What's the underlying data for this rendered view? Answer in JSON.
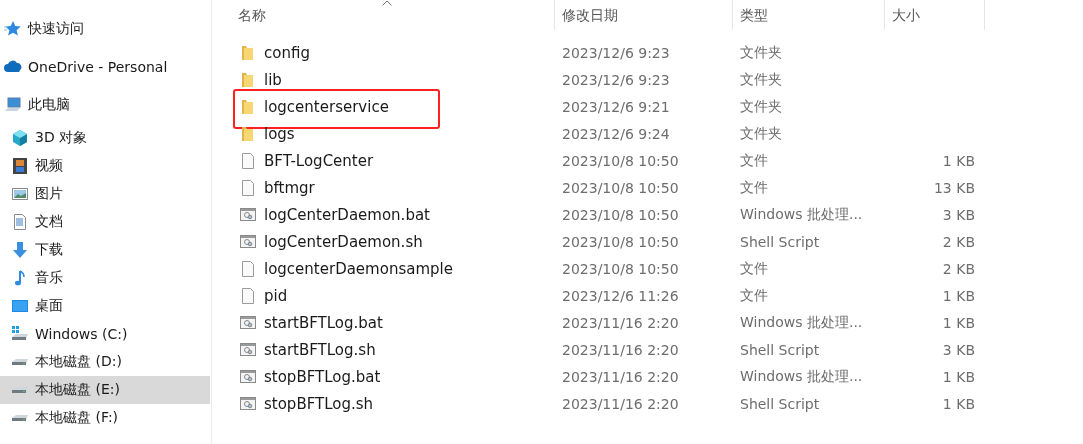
{
  "sidebar": {
    "items": [
      {
        "label": "快速访问",
        "kind": "star",
        "selected": false
      },
      {
        "label": "OneDrive - Personal",
        "kind": "cloud",
        "selected": false
      },
      {
        "label": "此电脑",
        "kind": "pc",
        "selected": false,
        "children": [
          {
            "label": "3D 对象",
            "kind": "cube",
            "selected": false
          },
          {
            "label": "视频",
            "kind": "film",
            "selected": false
          },
          {
            "label": "图片",
            "kind": "image",
            "selected": false
          },
          {
            "label": "文档",
            "kind": "doc",
            "selected": false
          },
          {
            "label": "下载",
            "kind": "download",
            "selected": false
          },
          {
            "label": "音乐",
            "kind": "music",
            "selected": false
          },
          {
            "label": "桌面",
            "kind": "desktop",
            "selected": false
          },
          {
            "label": "Windows  (C:)",
            "kind": "windrive",
            "selected": false
          },
          {
            "label": "本地磁盘 (D:)",
            "kind": "drive",
            "selected": false
          },
          {
            "label": "本地磁盘 (E:)",
            "kind": "drive",
            "selected": true
          },
          {
            "label": "本地磁盘 (F:)",
            "kind": "drive",
            "selected": false
          }
        ]
      }
    ]
  },
  "table": {
    "columns": [
      {
        "label": "名称",
        "sorted": true
      },
      {
        "label": "修改日期",
        "sorted": false
      },
      {
        "label": "类型",
        "sorted": false
      },
      {
        "label": "大小",
        "sorted": false
      }
    ],
    "rows": [
      {
        "kind": "folder",
        "name": "config",
        "date": "2023/12/6 9:23",
        "type": "文件夹",
        "size": "",
        "annotated": false
      },
      {
        "kind": "folder",
        "name": "lib",
        "date": "2023/12/6 9:23",
        "type": "文件夹",
        "size": "",
        "annotated": false
      },
      {
        "kind": "folder",
        "name": "logcenterservice",
        "date": "2023/12/6 9:21",
        "type": "文件夹",
        "size": "",
        "annotated": true
      },
      {
        "kind": "folder",
        "name": "logs",
        "date": "2023/12/6 9:24",
        "type": "文件夹",
        "size": "",
        "annotated": false
      },
      {
        "kind": "file",
        "name": "BFT-LogCenter",
        "date": "2023/10/8 10:50",
        "type": "文件",
        "size": "1 KB",
        "annotated": false
      },
      {
        "kind": "file",
        "name": "bftmgr",
        "date": "2023/10/8 10:50",
        "type": "文件",
        "size": "13 KB",
        "annotated": false
      },
      {
        "kind": "script",
        "name": "logCenterDaemon.bat",
        "date": "2023/10/8 10:50",
        "type": "Windows 批处理...",
        "size": "3 KB",
        "annotated": false
      },
      {
        "kind": "script",
        "name": "logCenterDaemon.sh",
        "date": "2023/10/8 10:50",
        "type": "Shell Script",
        "size": "2 KB",
        "annotated": false
      },
      {
        "kind": "file",
        "name": "logcenterDaemonsample",
        "date": "2023/10/8 10:50",
        "type": "文件",
        "size": "2 KB",
        "annotated": false
      },
      {
        "kind": "file",
        "name": "pid",
        "date": "2023/12/6 11:26",
        "type": "文件",
        "size": "1 KB",
        "annotated": false
      },
      {
        "kind": "script",
        "name": "startBFTLog.bat",
        "date": "2023/11/16 2:20",
        "type": "Windows 批处理...",
        "size": "1 KB",
        "annotated": false
      },
      {
        "kind": "script",
        "name": "startBFTLog.sh",
        "date": "2023/11/16 2:20",
        "type": "Shell Script",
        "size": "3 KB",
        "annotated": false
      },
      {
        "kind": "script",
        "name": "stopBFTLog.bat",
        "date": "2023/11/16 2:20",
        "type": "Windows 批处理...",
        "size": "1 KB",
        "annotated": false
      },
      {
        "kind": "script",
        "name": "stopBFTLog.sh",
        "date": "2023/11/16 2:20",
        "type": "Shell Script",
        "size": "1 KB",
        "annotated": false
      }
    ]
  }
}
